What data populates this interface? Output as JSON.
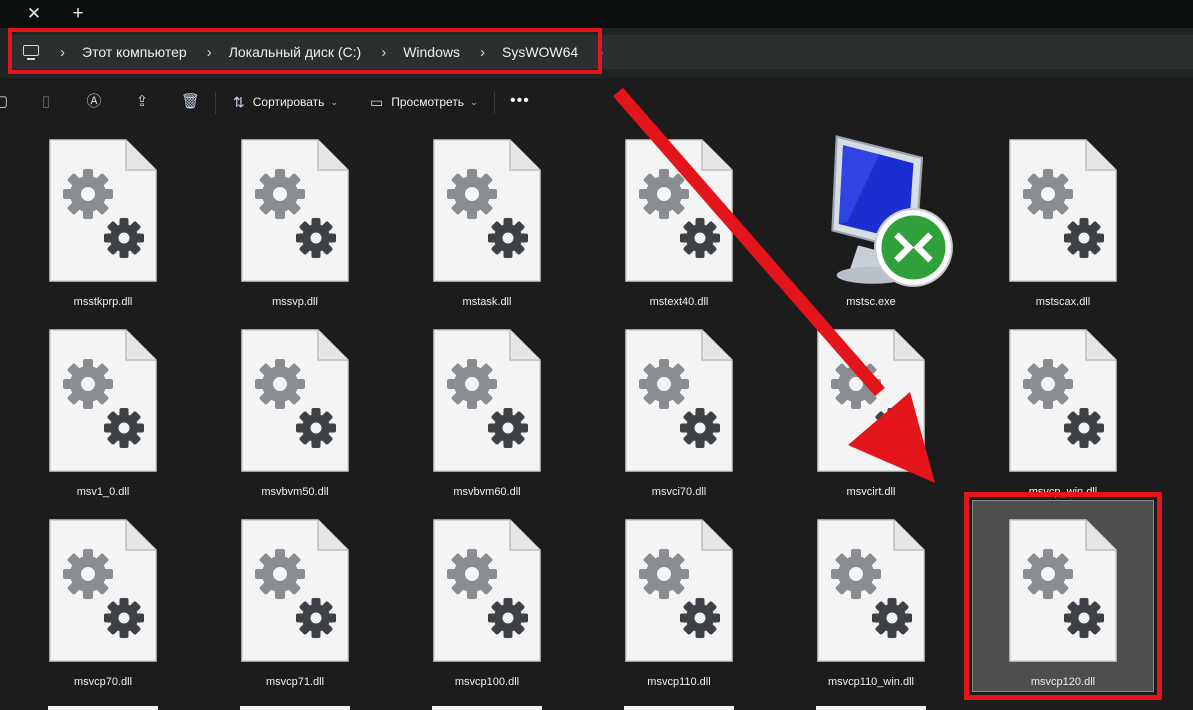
{
  "tabs": {
    "close_glyph": "✕",
    "new_glyph": "+"
  },
  "address": {
    "crumbs": [
      "Этот компьютер",
      "Локальный диск (C:)",
      "Windows",
      "SysWOW64"
    ]
  },
  "toolbar": {
    "sort_label": "Сортировать",
    "view_label": "Просмотреть",
    "more_label": "•••"
  },
  "files": [
    {
      "name": "msstkprp.dll",
      "icon": "dll-gear-icon"
    },
    {
      "name": "mssvp.dll",
      "icon": "dll-gear-icon"
    },
    {
      "name": "mstask.dll",
      "icon": "dll-gear-icon"
    },
    {
      "name": "mstext40.dll",
      "icon": "dll-gear-icon"
    },
    {
      "name": "mstsc.exe",
      "icon": "remote-desktop-icon"
    },
    {
      "name": "mstscax.dll",
      "icon": "dll-gear-icon"
    },
    {
      "name": "msv1_0.dll",
      "icon": "dll-gear-icon"
    },
    {
      "name": "msvbvm50.dll",
      "icon": "dll-gear-icon"
    },
    {
      "name": "msvbvm60.dll",
      "icon": "dll-gear-icon"
    },
    {
      "name": "msvci70.dll",
      "icon": "dll-gear-icon"
    },
    {
      "name": "msvcirt.dll",
      "icon": "dll-gear-icon"
    },
    {
      "name": "msvcp_win.dll",
      "icon": "dll-gear-icon"
    },
    {
      "name": "msvcp70.dll",
      "icon": "dll-gear-icon"
    },
    {
      "name": "msvcp71.dll",
      "icon": "dll-gear-icon"
    },
    {
      "name": "msvcp100.dll",
      "icon": "dll-gear-icon"
    },
    {
      "name": "msvcp110.dll",
      "icon": "dll-gear-icon"
    },
    {
      "name": "msvcp110_win.dll",
      "icon": "dll-gear-icon"
    },
    {
      "name": "msvcp120.dll",
      "icon": "dll-gear-icon",
      "selected": true
    }
  ],
  "colors": {
    "highlight": "#e3141a",
    "background": "#1c1c1c",
    "selection": "#4e4e4e"
  }
}
